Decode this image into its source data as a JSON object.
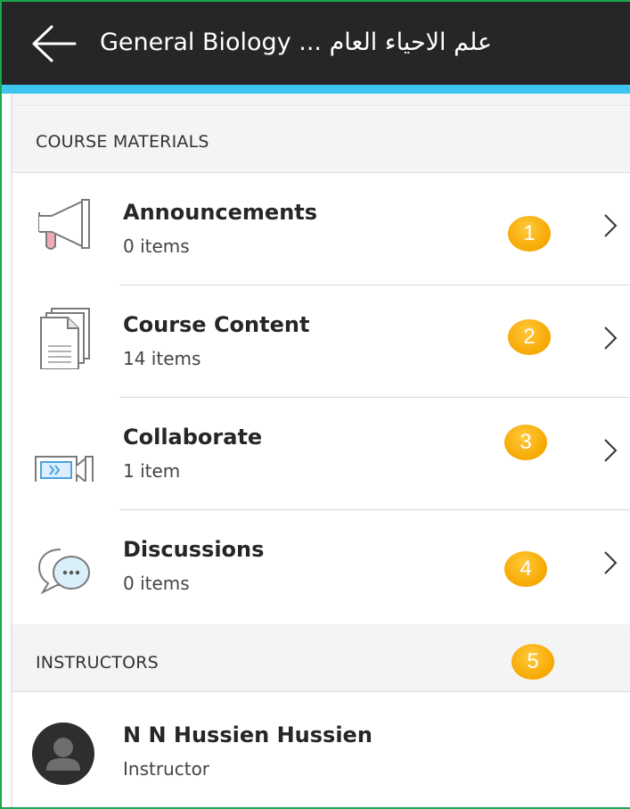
{
  "header": {
    "back_icon": "back-arrow-icon",
    "title": "General Biology ... علم الاحياء العام"
  },
  "colors": {
    "header_bg": "#262626",
    "accent": "#3ec6f0",
    "badge": "#f6a800",
    "frame": "#1aa84a"
  },
  "course_materials": {
    "heading": "COURSE MATERIALS",
    "items": [
      {
        "title": "Announcements",
        "count": "0 items",
        "icon": "megaphone-icon",
        "badge": "1"
      },
      {
        "title": "Course Content",
        "count": "14 items",
        "icon": "document-stack-icon",
        "badge": "2"
      },
      {
        "title": "Collaborate",
        "count": "1 item",
        "icon": "video-camera-icon",
        "badge": "3"
      },
      {
        "title": "Discussions",
        "count": "0 items",
        "icon": "chat-bubbles-icon",
        "badge": "4"
      }
    ]
  },
  "instructors": {
    "heading": "INSTRUCTORS",
    "badge": "5",
    "list": [
      {
        "name": "N N Hussien Hussien",
        "role": "Instructor",
        "icon": "avatar-icon"
      }
    ]
  }
}
